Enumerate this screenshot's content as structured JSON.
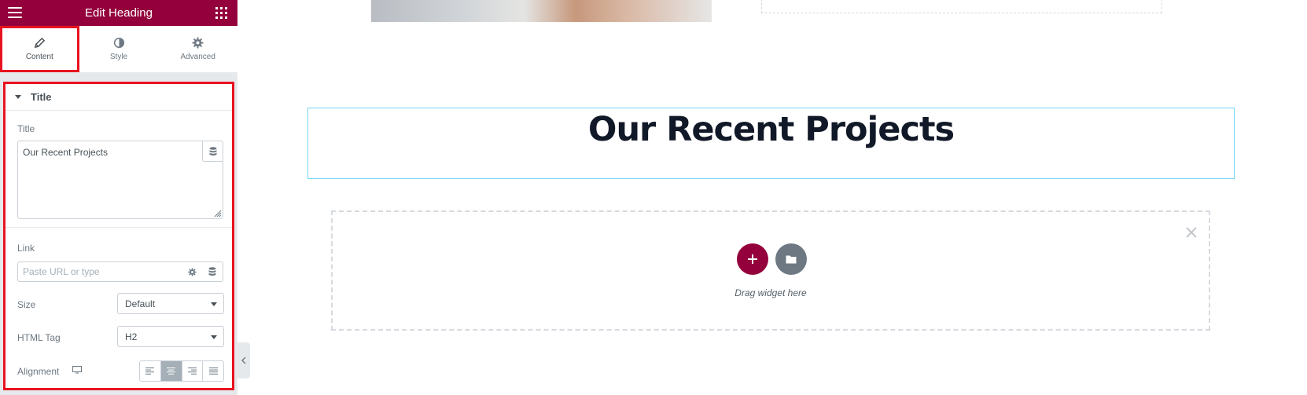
{
  "header": {
    "title": "Edit Heading"
  },
  "tabs": [
    {
      "label": "Content",
      "icon": "pencil-icon",
      "active": true
    },
    {
      "label": "Style",
      "icon": "contrast-icon",
      "active": false
    },
    {
      "label": "Advanced",
      "icon": "gear-icon",
      "active": false
    }
  ],
  "section": {
    "title": "Title"
  },
  "controls": {
    "title_label": "Title",
    "title_value": "Our Recent Projects",
    "link_label": "Link",
    "link_placeholder": "Paste URL or type",
    "size_label": "Size",
    "size_value": "Default",
    "html_tag_label": "HTML Tag",
    "html_tag_value": "H2",
    "alignment_label": "Alignment",
    "alignment_options": [
      "left",
      "center",
      "right",
      "justify"
    ],
    "alignment_selected": "center"
  },
  "canvas": {
    "heading": "Our Recent Projects",
    "drag_text": "Drag widget here"
  },
  "colors": {
    "brand": "#93003c",
    "highlight": "#e8131f",
    "selection_outline": "#71d7f7",
    "heading_text": "#111827"
  }
}
